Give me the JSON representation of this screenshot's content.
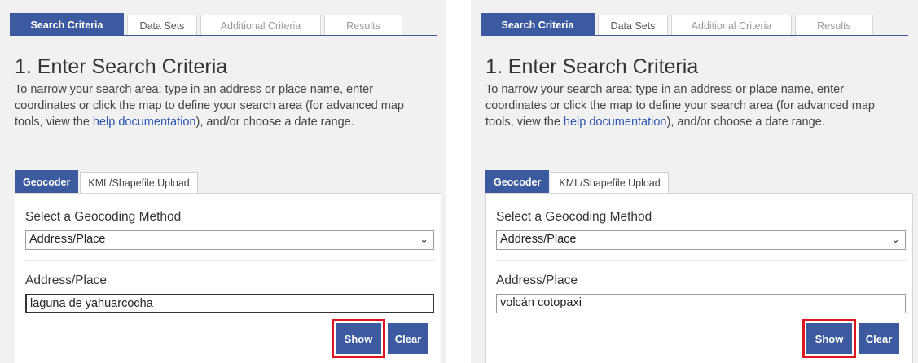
{
  "panels": [
    {
      "tabs": [
        "Search Criteria",
        "Data Sets",
        "Additional Criteria",
        "Results"
      ],
      "title": "1. Enter Search Criteria",
      "desc_before": "To narrow your search area: type in an address or place name, enter coordinates or click the map to define your search area (for advanced map tools, view the ",
      "desc_link": "help documentation",
      "desc_after": "), and/or choose a date range.",
      "subtabs": [
        "Geocoder",
        "KML/Shapefile Upload"
      ],
      "method_label": "Select a Geocoding Method",
      "method_value": "Address/Place",
      "address_label": "Address/Place",
      "address_value": "laguna de yahuarcocha",
      "show_label": "Show",
      "clear_label": "Clear"
    },
    {
      "tabs": [
        "Search Criteria",
        "Data Sets",
        "Additional Criteria",
        "Results"
      ],
      "title": "1. Enter Search Criteria",
      "desc_before": "To narrow your search area: type in an address or place name, enter coordinates or click the map to define your search area (for advanced map tools, view the ",
      "desc_link": "help documentation",
      "desc_after": "), and/or choose a date range.",
      "subtabs": [
        "Geocoder",
        "KML/Shapefile Upload"
      ],
      "method_label": "Select a Geocoding Method",
      "method_value": "Address/Place",
      "address_label": "Address/Place",
      "address_value": "volcán cotopaxi",
      "show_label": "Show",
      "clear_label": "Clear"
    }
  ],
  "icons": {
    "dropdown": "chevron-down-icon"
  },
  "colors": {
    "accent": "#3c5aa0",
    "highlight": "#e0141e",
    "link": "#2a56b3"
  }
}
